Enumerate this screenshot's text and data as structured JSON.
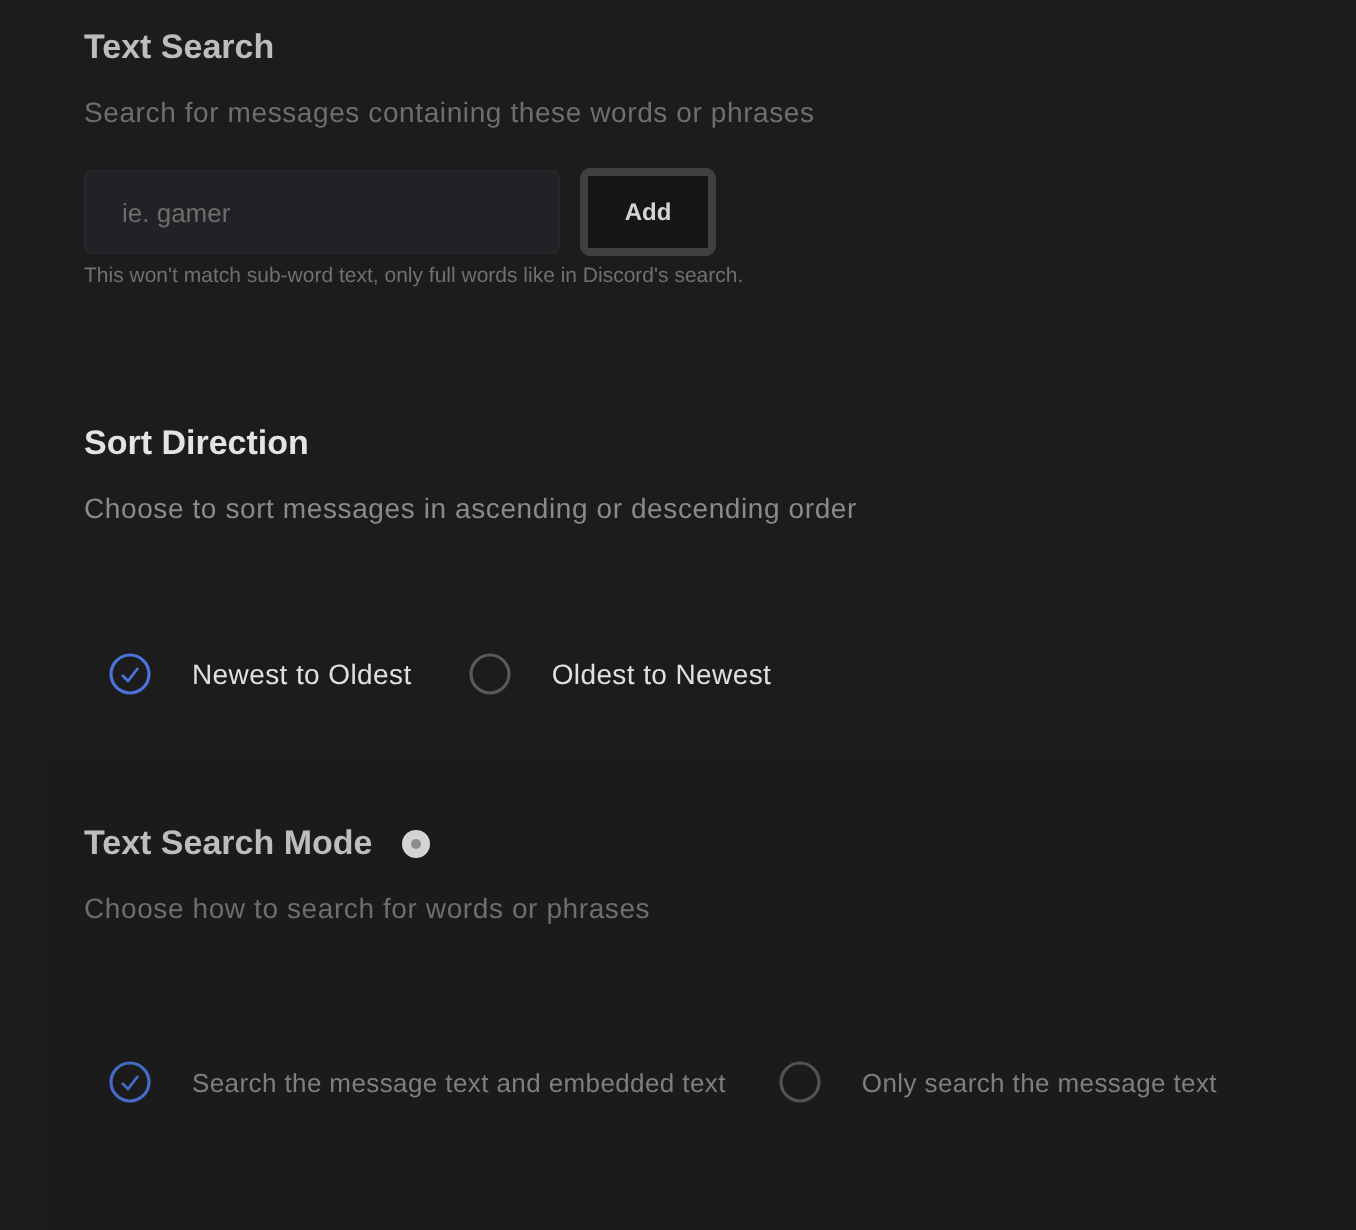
{
  "sections": [
    {
      "title": "Text Search",
      "description": "Search for messages containing these words or phrases",
      "dimmed": true,
      "kind": "input",
      "input": {
        "placeholder": "ie. gamer"
      },
      "button": "Add",
      "note": "This won't match sub-word text, only full words like in Discord's search."
    },
    {
      "title": "Sort Direction",
      "description": "Choose to sort messages in ascending or descending order",
      "dimmed": false,
      "kind": "radio",
      "options": [
        {
          "label": "Newest to Oldest",
          "selected": true
        },
        {
          "label": "Oldest to Newest",
          "selected": false
        }
      ]
    },
    {
      "title": "Text Search Mode",
      "info": true,
      "description": "Choose how to search for words or phrases",
      "dimmed": true,
      "kind": "radio",
      "options": [
        {
          "label": "Search the message text and embedded text",
          "selected": true
        },
        {
          "label": "Only search the message text",
          "selected": false
        }
      ]
    }
  ]
}
